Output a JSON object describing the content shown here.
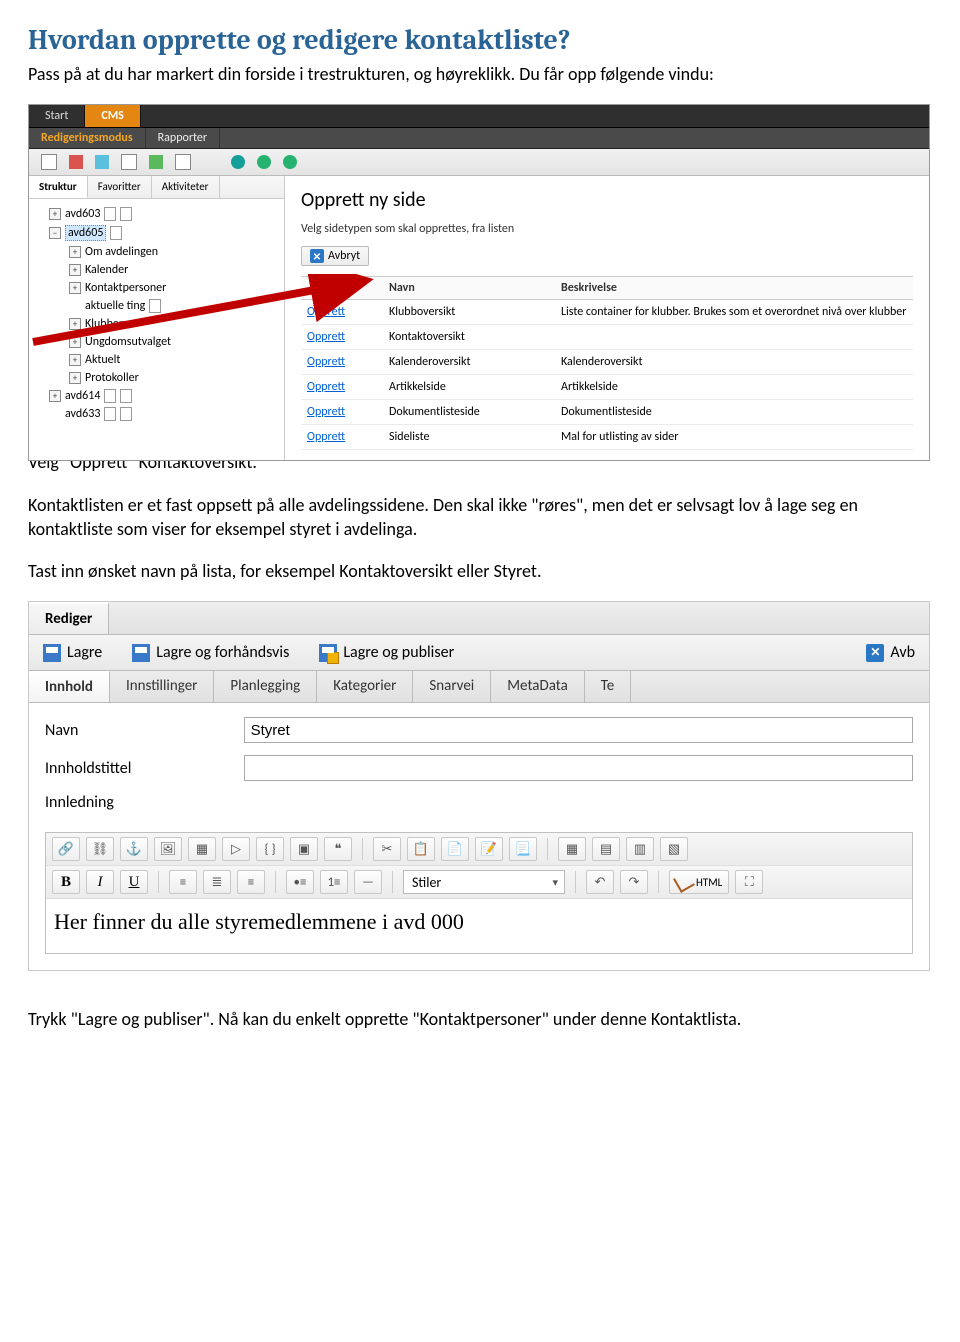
{
  "title": "Hvordan opprette og redigere kontaktliste?",
  "intro": "Pass på at du har markert din forside i trestrukturen, og høyreklikk. Du får opp følgende vindu:",
  "cms": {
    "top": {
      "start": "Start",
      "cms": "CMS"
    },
    "sub": {
      "redigering": "Redigeringsmodus",
      "rapporter": "Rapporter"
    },
    "tree": {
      "tabs": {
        "struktur": "Struktur",
        "favoritter": "Favoritter",
        "aktiviteter": "Aktiviteter"
      },
      "nodes": {
        "avd603": "avd603",
        "avd605": "avd605",
        "om": "Om avdelingen",
        "kalender": "Kalender",
        "kontakt": "Kontaktpersoner",
        "aktuelle": "aktuelle ting",
        "klubber": "Klubber",
        "ungdom": "Ungdomsutvalget",
        "aktuelt": "Aktuelt",
        "protokoller": "Protokoller",
        "avd614": "avd614",
        "avd633": "avd633"
      }
    },
    "opprett": {
      "title": "Opprett ny side",
      "sub": "Velg sidetypen som skal opprettes, fra listen",
      "avbryt": "Avbryt",
      "headers": {
        "empty": "",
        "navn": "Navn",
        "beskrivelse": "Beskrivelse"
      },
      "link": "Opprett",
      "rows": [
        {
          "navn": "Klubboversikt",
          "besk": "Liste container for klubber. Brukes som et overordnet nivå over klubber"
        },
        {
          "navn": "Kontaktoversikt",
          "besk": ""
        },
        {
          "navn": "Kalenderoversikt",
          "besk": "Kalenderoversikt"
        },
        {
          "navn": "Artikkelside",
          "besk": "Artikkelside"
        },
        {
          "navn": "Dokumentlisteside",
          "besk": "Dokumentlisteside"
        },
        {
          "navn": "Sideliste",
          "besk": "Mal for utlisting av sider"
        }
      ]
    }
  },
  "mid1": "Velg \"Opprett\" Kontaktoversikt.",
  "mid2": "Kontaktlisten er et fast oppsett på alle avdelingssidene. Den skal ikke \"røres\", men det er selvsagt lov å lage seg en kontaktliste som viser for eksempel styret i avdelinga.",
  "mid3": "Tast inn ønsket navn på lista, for eksempel Kontaktoversikt eller Styret.",
  "editor": {
    "rediger": "Rediger",
    "toolbar": {
      "lagre": "Lagre",
      "lagre_preview": "Lagre og forhåndsvis",
      "lagre_publiser": "Lagre og publiser",
      "avb": "Avb"
    },
    "tabs": {
      "innhold": "Innhold",
      "innstillinger": "Innstillinger",
      "planlegging": "Planlegging",
      "kategorier": "Kategorier",
      "snarvei": "Snarvei",
      "metadata": "MetaData",
      "te": "Te"
    },
    "form": {
      "navn_label": "Navn",
      "navn_value": "Styret",
      "innholdstittel_label": "Innholdstittel",
      "innholdstittel_value": "",
      "innledning_label": "Innledning"
    },
    "rte": {
      "stiler": "Stiler",
      "html": "HTML",
      "content": "Her finner du alle styremedlemmene i avd 000"
    }
  },
  "footer": "Trykk \"Lagre og publiser\". Nå kan du enkelt opprette \"Kontaktpersoner\" under denne Kontaktlista."
}
